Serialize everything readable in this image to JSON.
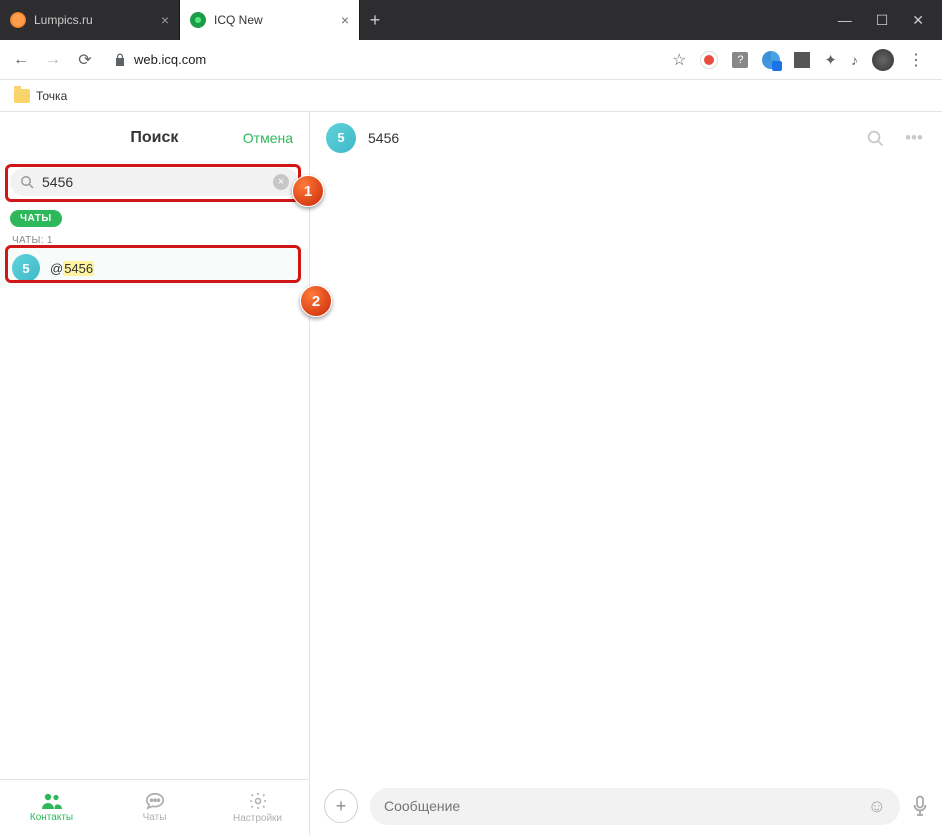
{
  "browser": {
    "tabs": [
      {
        "title": "Lumpics.ru",
        "active": false
      },
      {
        "title": "ICQ New",
        "active": true
      }
    ],
    "url_host": "web.icq.com",
    "bookmark": "Точка"
  },
  "sidebar": {
    "title": "Поиск",
    "cancel": "Отмена",
    "search_value": "5456",
    "pill_label": "ЧАТЫ",
    "section_label": "ЧАТЫ: 1",
    "result": {
      "avatar_letter": "5",
      "at": "@",
      "name_match": "5456"
    },
    "nav": {
      "contacts": "Контакты",
      "chats": "Чаты",
      "settings": "Настройки"
    }
  },
  "chat": {
    "avatar_letter": "5",
    "title": "5456",
    "composer_placeholder": "Сообщение"
  },
  "markers": {
    "one": "1",
    "two": "2"
  }
}
